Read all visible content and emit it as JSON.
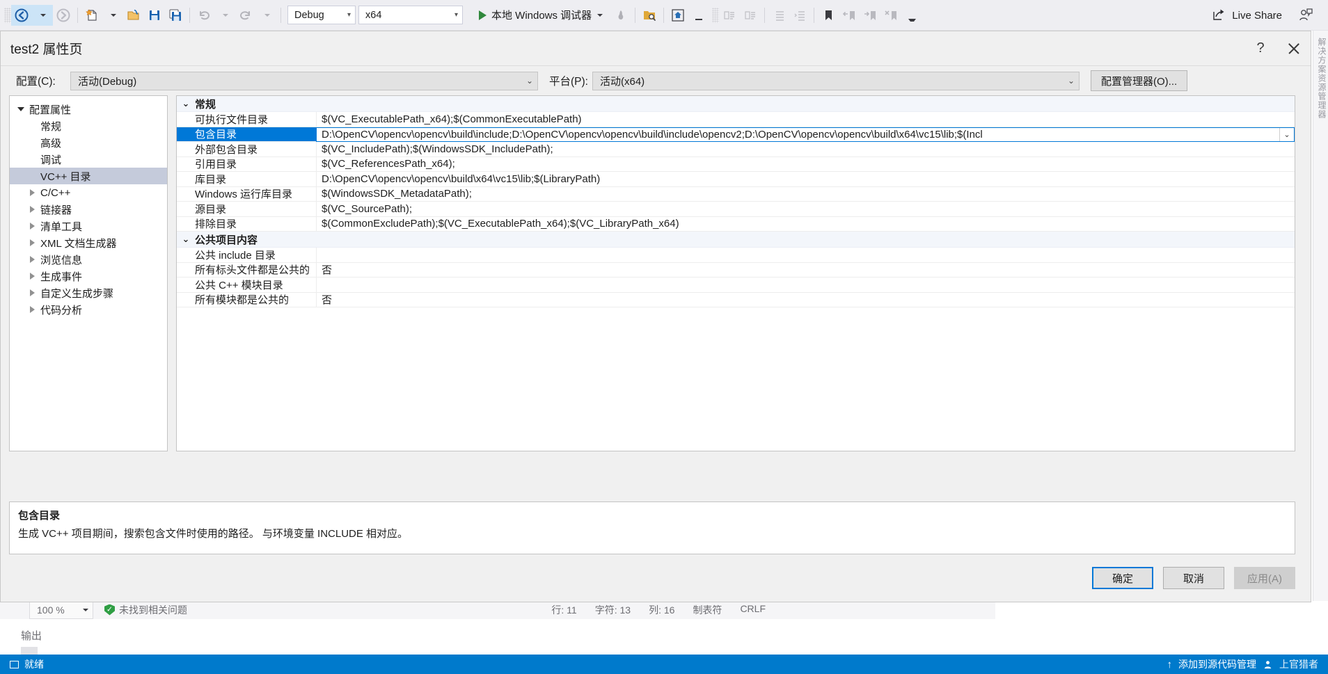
{
  "toolbar": {
    "navigate_back_icon": "back-arrow-icon",
    "navigate_forward_icon": "forward-arrow-icon",
    "new_item_icon": "new-file-icon",
    "open_icon": "open-folder-icon",
    "save_icon": "save-icon",
    "save_all_icon": "save-all-icon",
    "undo_icon": "undo-icon",
    "redo_icon": "redo-icon",
    "config_value": "Debug",
    "platform_value": "x64",
    "run_label": "本地 Windows 调试器",
    "hot_reload_icon": "hot-reload-icon",
    "search_folder_icon": "search-folder-icon",
    "home_icon": "home-icon",
    "live_share_label": "Live Share",
    "live_share_icon": "share-icon",
    "account_icon": "account-icon",
    "bookmark_icon": "bookmark-icon",
    "prev_bookmark_icon": "previous-bookmark-icon",
    "next_bookmark_icon": "next-bookmark-icon",
    "clear_bookmark_icon": "clear-bookmark-icon",
    "indent_icon": "indent-icon",
    "comment_icon": "comment-icon",
    "uncomment_icon": "uncomment-icon",
    "overflow_icon": "toolbar-overflow-icon"
  },
  "dialog": {
    "title": "test2 属性页",
    "help_label": "?",
    "close_icon": "close-icon",
    "config": {
      "label": "配置(C):",
      "value": "活动(Debug)"
    },
    "platform": {
      "label": "平台(P):",
      "value": "活动(x64)"
    },
    "config_manager_button": "配置管理器(O)...",
    "tree": [
      {
        "label": "配置属性",
        "level": 0,
        "expander": "down",
        "selected": false
      },
      {
        "label": "常规",
        "level": 1,
        "expander": "none",
        "selected": false
      },
      {
        "label": "高级",
        "level": 1,
        "expander": "none",
        "selected": false
      },
      {
        "label": "调试",
        "level": 1,
        "expander": "none",
        "selected": false
      },
      {
        "label": "VC++ 目录",
        "level": 1,
        "expander": "none",
        "selected": true
      },
      {
        "label": "C/C++",
        "level": 1,
        "expander": "right",
        "selected": false
      },
      {
        "label": "链接器",
        "level": 1,
        "expander": "right",
        "selected": false
      },
      {
        "label": "清单工具",
        "level": 1,
        "expander": "right",
        "selected": false
      },
      {
        "label": "XML 文档生成器",
        "level": 1,
        "expander": "right",
        "selected": false
      },
      {
        "label": "浏览信息",
        "level": 1,
        "expander": "right",
        "selected": false
      },
      {
        "label": "生成事件",
        "level": 1,
        "expander": "right",
        "selected": false
      },
      {
        "label": "自定义生成步骤",
        "level": 1,
        "expander": "right",
        "selected": false
      },
      {
        "label": "代码分析",
        "level": 1,
        "expander": "right",
        "selected": false
      }
    ],
    "groups": [
      {
        "title": "常规",
        "expanded": true,
        "rows": [
          {
            "name": "可执行文件目录",
            "value": "$(VC_ExecutablePath_x64);$(CommonExecutablePath)",
            "selected": false,
            "dropdown": false
          },
          {
            "name": "包含目录",
            "value": "D:\\OpenCV\\opencv\\opencv\\build\\include;D:\\OpenCV\\opencv\\opencv\\build\\include\\opencv2;D:\\OpenCV\\opencv\\opencv\\build\\x64\\vc15\\lib;$(Incl",
            "selected": true,
            "dropdown": true
          },
          {
            "name": "外部包含目录",
            "value": "$(VC_IncludePath);$(WindowsSDK_IncludePath);",
            "selected": false,
            "dropdown": false
          },
          {
            "name": "引用目录",
            "value": "$(VC_ReferencesPath_x64);",
            "selected": false,
            "dropdown": false
          },
          {
            "name": "库目录",
            "value": "D:\\OpenCV\\opencv\\opencv\\build\\x64\\vc15\\lib;$(LibraryPath)",
            "selected": false,
            "dropdown": false
          },
          {
            "name": "Windows 运行库目录",
            "value": "$(WindowsSDK_MetadataPath);",
            "selected": false,
            "dropdown": false
          },
          {
            "name": "源目录",
            "value": "$(VC_SourcePath);",
            "selected": false,
            "dropdown": false
          },
          {
            "name": "排除目录",
            "value": "$(CommonExcludePath);$(VC_ExecutablePath_x64);$(VC_LibraryPath_x64)",
            "selected": false,
            "dropdown": false
          }
        ]
      },
      {
        "title": "公共项目内容",
        "expanded": true,
        "rows": [
          {
            "name": "公共 include 目录",
            "value": "",
            "selected": false,
            "dropdown": false
          },
          {
            "name": "所有标头文件都是公共的",
            "value": "否",
            "selected": false,
            "dropdown": false
          },
          {
            "name": "公共 C++ 模块目录",
            "value": "",
            "selected": false,
            "dropdown": false
          },
          {
            "name": "所有模块都是公共的",
            "value": "否",
            "selected": false,
            "dropdown": false
          }
        ]
      }
    ],
    "description": {
      "title": "包含目录",
      "text": "生成 VC++ 项目期间，搜索包含文件时使用的路径。 与环境变量 INCLUDE 相对应。"
    },
    "buttons": {
      "ok": "确定",
      "cancel": "取消",
      "apply": "应用(A)"
    }
  },
  "editor_status": {
    "zoom": "100 %",
    "problem_status": "未找到相关问题",
    "line": "行: 11",
    "char": "字符: 13",
    "col": "列: 16",
    "tabs": "制表符",
    "eol": "CRLF"
  },
  "panels": {
    "output_label": "输出"
  },
  "statusbar": {
    "ready": "就绪",
    "source_control": "添加到源代码管理",
    "account": "上官猎者",
    "window_icon": "window-icon",
    "up_arrow_icon": "up-arrow-icon",
    "person_icon": "person-icon"
  },
  "right_strip": {
    "text": "解决方案资源管理器"
  },
  "colors": {
    "accent": "#007acc",
    "selection_blue": "#0078d7",
    "tree_selection": "#c5cbdb",
    "toolbar_bg": "#eeeef2",
    "group_bg": "#f3f6fb"
  }
}
